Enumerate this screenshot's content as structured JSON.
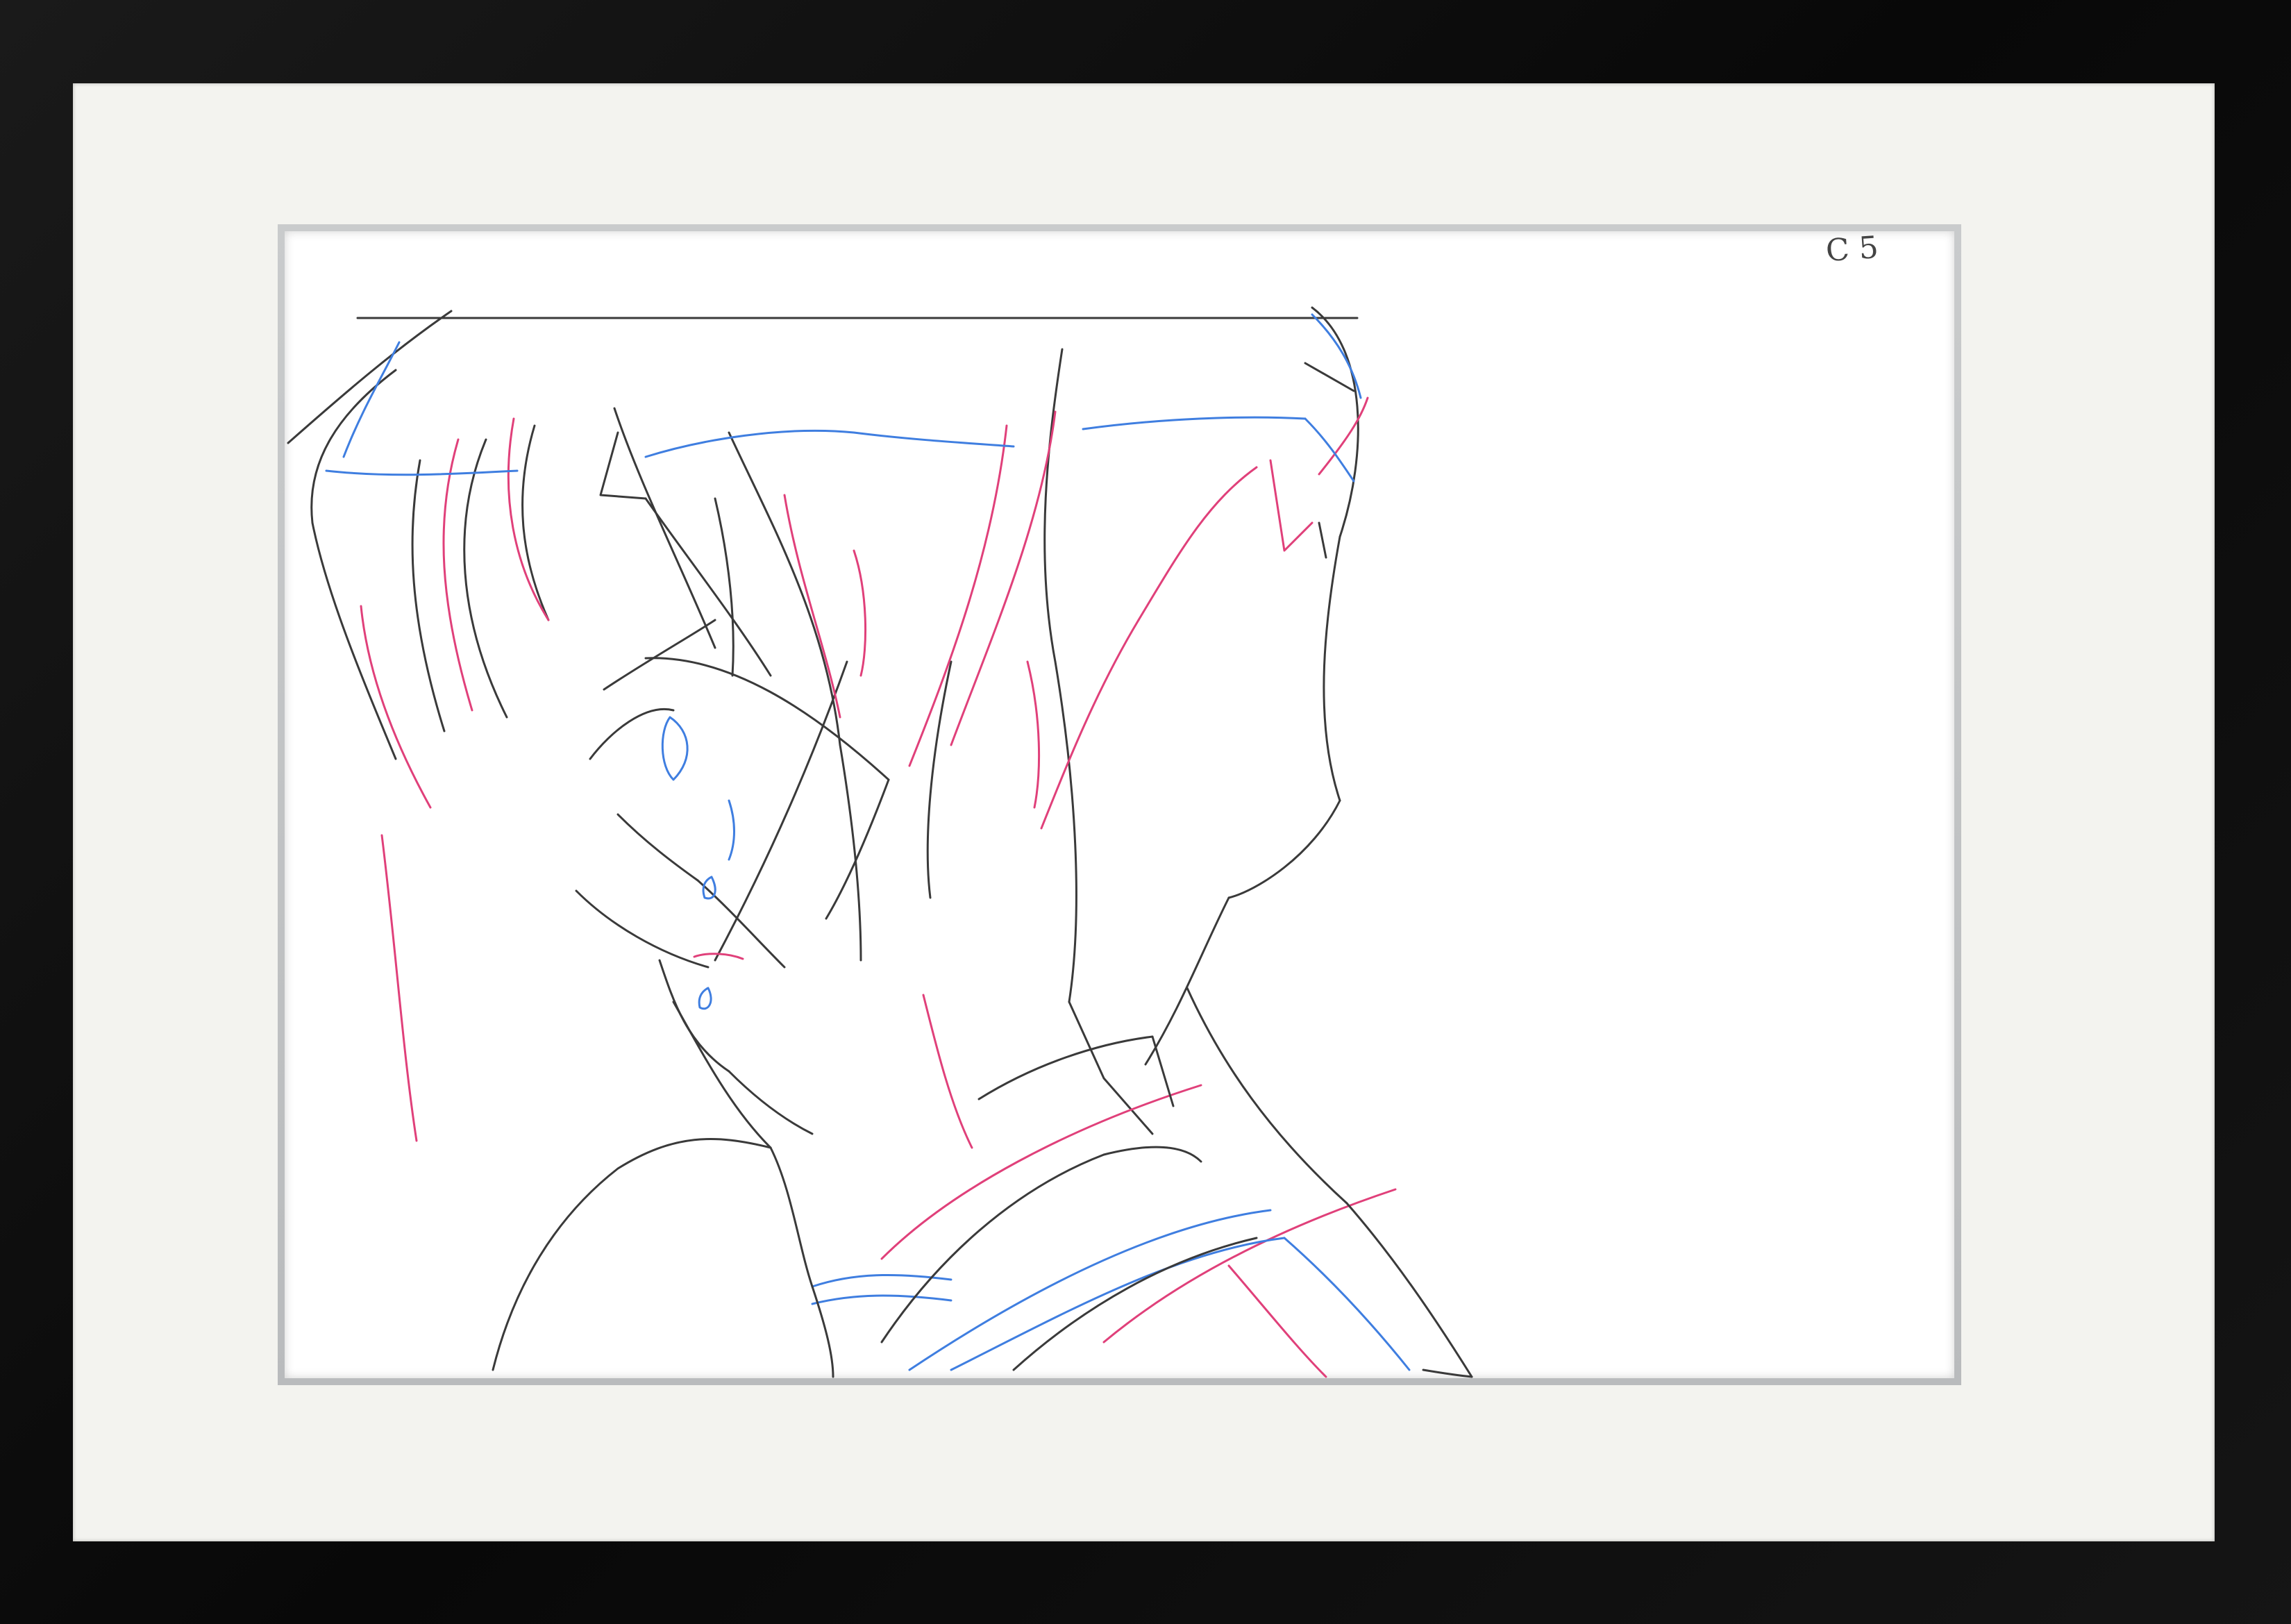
{
  "artwork": {
    "cut_label": "C5",
    "line_colors": {
      "graphite": "#3a3a3a",
      "red_pencil": "#e0407a",
      "blue_pencil": "#3f7ee0"
    },
    "frame_color": "#0d0d0d",
    "mat_color": "#f3f3ef",
    "paper_color": "#ffffff"
  }
}
